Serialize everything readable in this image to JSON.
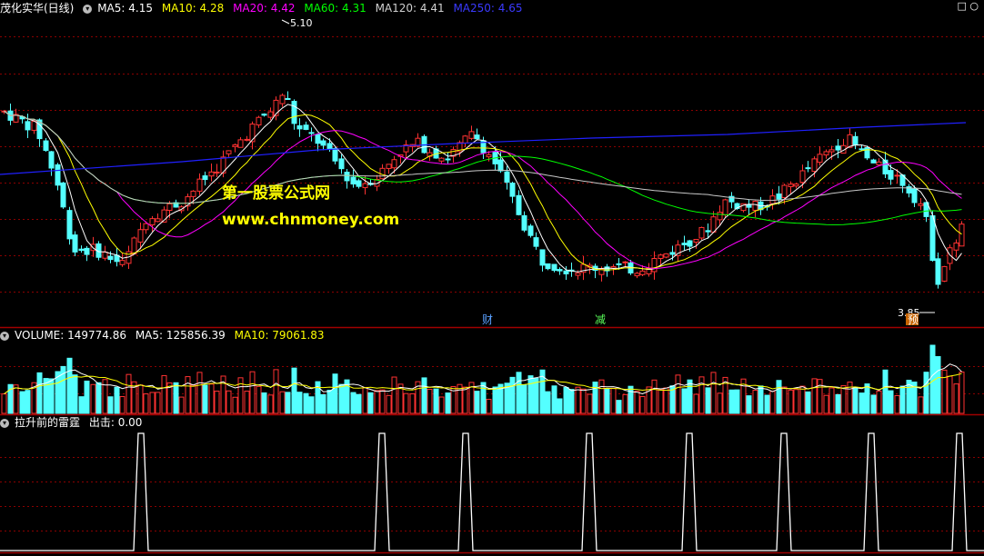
{
  "header": {
    "title": "茂化实华(日线)",
    "ma5": "MA5: 4.15",
    "ma10": "MA10: 4.28",
    "ma20": "MA20: 4.42",
    "ma60": "MA60: 4.31",
    "ma120": "MA120: 4.41",
    "ma250": "MA250: 4.65"
  },
  "volume_header": {
    "label": "VOLUME: 149774.86",
    "ma5": "MA5: 125856.39",
    "ma10": "MA10: 79061.83"
  },
  "indicator_header": {
    "label": "拉升前的雷霆",
    "value": "出击: 0.00"
  },
  "watermark": {
    "line1": "第一股票公式网",
    "line2": "www.chnmoney.com"
  },
  "markers": {
    "cai": "财",
    "jian": "减",
    "yu": "预"
  },
  "annotations": {
    "high": "5.10",
    "low": "3.85"
  },
  "colors": {
    "up": "#ff3232",
    "down": "#54ffff",
    "ma5": "#ffffff",
    "ma10": "#ffff00",
    "ma20": "#ff00ff",
    "ma60": "#00ff00",
    "ma120": "#c8c8c8",
    "ma250": "#2020ff",
    "grid": "#8b0000",
    "border": "#a00000"
  },
  "chart_data": [
    {
      "type": "candlestick",
      "title": "茂化实华(日线)",
      "price_range": [
        3.75,
        5.15
      ],
      "series_names": [
        "MA5",
        "MA10",
        "MA20",
        "MA60",
        "MA120",
        "MA250"
      ],
      "last_values": {
        "MA5": 4.15,
        "MA10": 4.28,
        "MA20": 4.42,
        "MA60": 4.31,
        "MA120": 4.41,
        "MA250": 4.65
      },
      "annotations": [
        {
          "label": "5.10"
        },
        {
          "label": "3.85"
        }
      ]
    },
    {
      "type": "bar",
      "title": "VOLUME",
      "last_values": {
        "VOLUME": 149774.86,
        "MA5": 125856.39,
        "MA10": 79061.83
      }
    },
    {
      "type": "line",
      "title": "拉升前的雷霆",
      "series_names": [
        "出击"
      ],
      "last_value": 0.0,
      "signal_count": 8
    }
  ]
}
